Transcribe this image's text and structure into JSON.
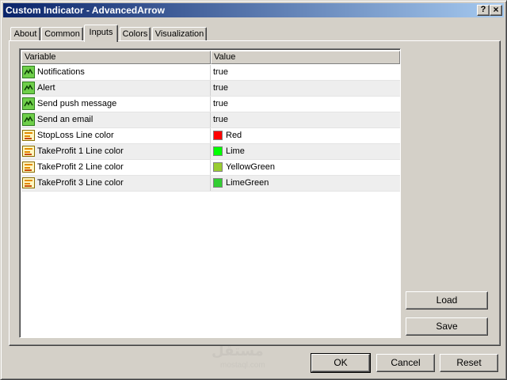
{
  "window": {
    "title": "Custom Indicator - AdvancedArrow",
    "help_label": "?",
    "close_label": "×"
  },
  "tabs": [
    {
      "label": "About"
    },
    {
      "label": "Common"
    },
    {
      "label": "Inputs",
      "active": true
    },
    {
      "label": "Colors"
    },
    {
      "label": "Visualization"
    }
  ],
  "grid": {
    "headers": {
      "variable": "Variable",
      "value": "Value"
    },
    "rows": [
      {
        "variable": "Notifications",
        "value": "true",
        "icon": "boolean-icon"
      },
      {
        "variable": "Alert",
        "value": "true",
        "icon": "boolean-icon"
      },
      {
        "variable": "Send push message",
        "value": "true",
        "icon": "boolean-icon"
      },
      {
        "variable": "Send an email",
        "value": "true",
        "icon": "boolean-icon"
      },
      {
        "variable": "StopLoss Line color",
        "value": "Red",
        "icon": "color-icon",
        "swatch": "#ff0000"
      },
      {
        "variable": "TakeProfit 1 Line color",
        "value": "Lime",
        "icon": "color-icon",
        "swatch": "#00ff00"
      },
      {
        "variable": "TakeProfit 2 Line color",
        "value": "YellowGreen",
        "icon": "color-icon",
        "swatch": "#9acd32"
      },
      {
        "variable": "TakeProfit 3 Line color",
        "value": "LimeGreen",
        "icon": "color-icon",
        "swatch": "#32cd32"
      }
    ]
  },
  "side_buttons": {
    "load": "Load",
    "save": "Save"
  },
  "footer_buttons": {
    "ok": "OK",
    "cancel": "Cancel",
    "reset": "Reset"
  },
  "watermark": {
    "text": "مستقل",
    "subtext": "mostaql.com"
  }
}
